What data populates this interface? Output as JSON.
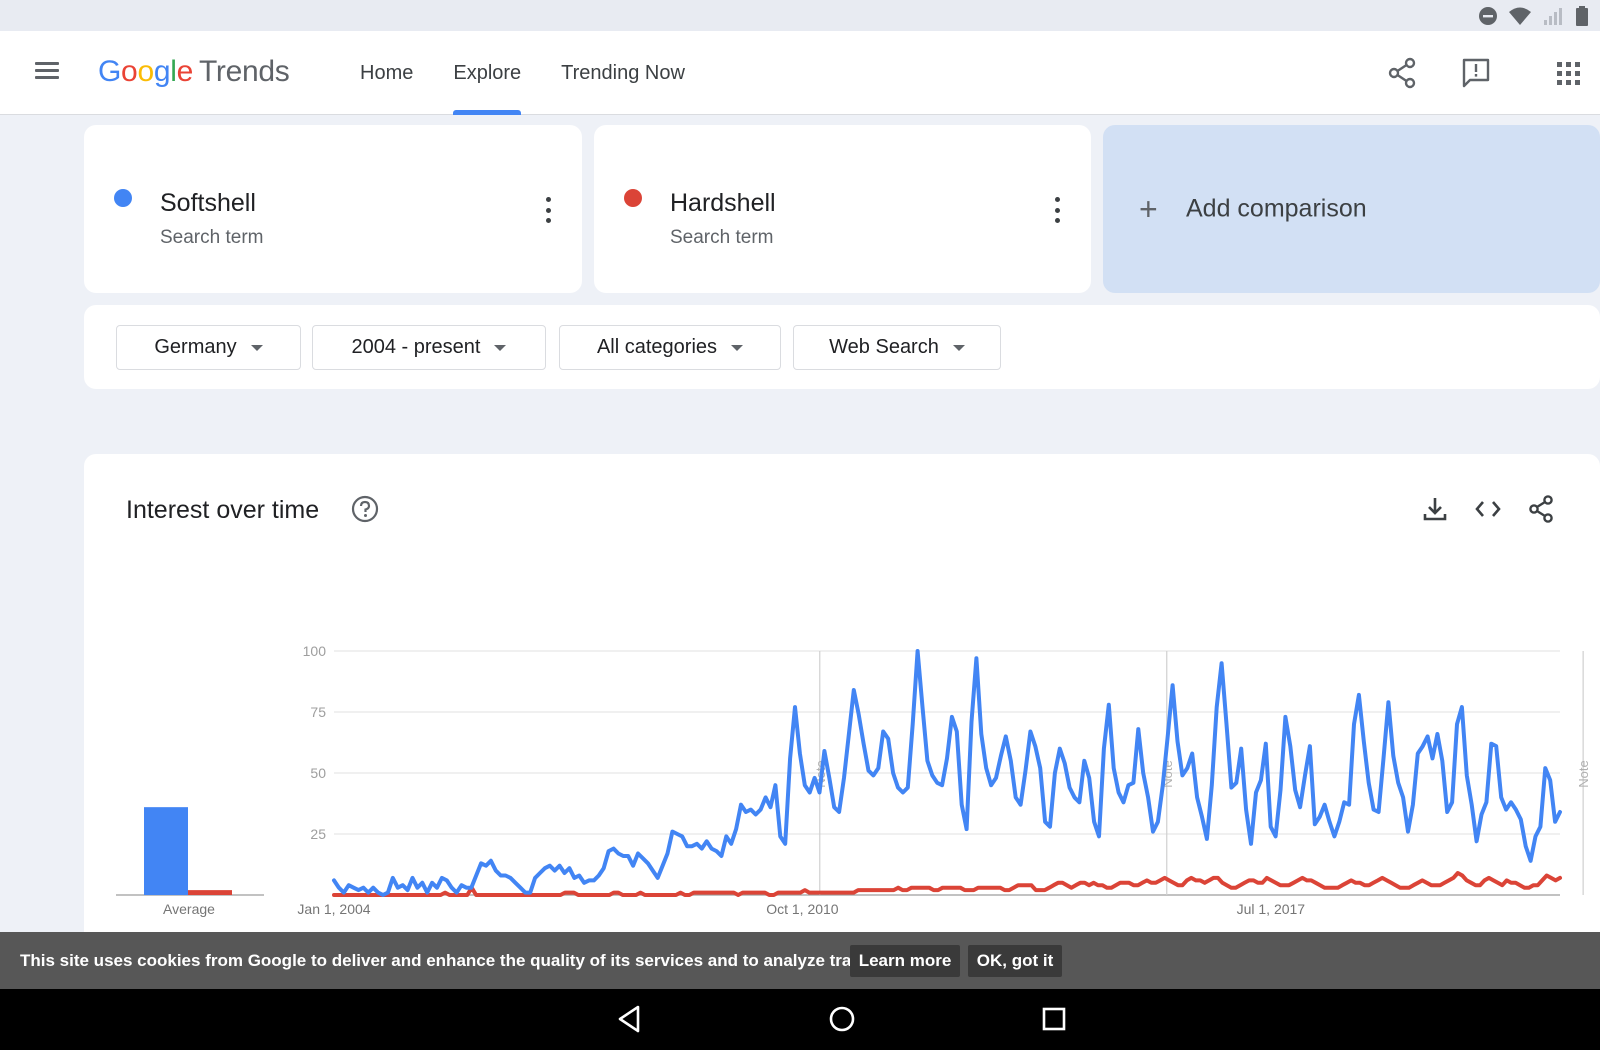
{
  "app": {
    "logo_google": [
      "G",
      "o",
      "o",
      "g",
      "l",
      "e"
    ],
    "logo_trends": "Trends"
  },
  "nav": {
    "tabs": [
      {
        "label": "Home",
        "active": false
      },
      {
        "label": "Explore",
        "active": true
      },
      {
        "label": "Trending Now",
        "active": false
      }
    ]
  },
  "terms": [
    {
      "name": "Softshell",
      "subtitle": "Search term",
      "color": "#4285f4"
    },
    {
      "name": "Hardshell",
      "subtitle": "Search term",
      "color": "#db4437"
    }
  ],
  "add_comparison": {
    "plus": "+",
    "label": "Add comparison"
  },
  "filters": {
    "region": "Germany",
    "time": "2004 - present",
    "category": "All categories",
    "search_type": "Web Search"
  },
  "interest": {
    "title": "Interest over time",
    "average_label": "Average"
  },
  "cookie": {
    "text": "This site uses cookies from Google to deliver and enhance the quality of its services and to analyze traffic.",
    "learn_more": "Learn more",
    "ok": "OK, got it"
  },
  "colors": {
    "blue": "#4285f4",
    "red": "#db4437",
    "accent": "#4285f4"
  },
  "chart_data": {
    "type": "line",
    "title": "Interest over time",
    "x_start": "2004-01",
    "x_end": "2021-09",
    "ylim": [
      0,
      100
    ],
    "y_ticks": [
      25,
      50,
      75,
      100
    ],
    "x_tick_labels": [
      {
        "label": "Jan 1, 2004",
        "date": "2004-01"
      },
      {
        "label": "Oct 1, 2010",
        "date": "2010-10"
      },
      {
        "label": "Jul 1, 2017",
        "date": "2017-07"
      }
    ],
    "notes": [
      {
        "label": "Note",
        "date": "2011-01"
      },
      {
        "label": "Note",
        "date": "2016-01"
      },
      {
        "label": "Note",
        "date": "2022-01"
      }
    ],
    "average": {
      "Softshell": 36,
      "Hardshell": 2
    },
    "series": [
      {
        "name": "Softshell",
        "color": "#4285f4",
        "values": [
          6,
          3,
          1,
          4,
          3,
          2,
          3,
          1,
          3,
          1,
          0,
          1,
          7,
          3,
          4,
          2,
          7,
          3,
          5,
          1,
          5,
          3,
          7,
          6,
          3,
          1,
          4,
          3,
          3,
          8,
          13,
          12,
          14,
          10,
          8,
          8,
          7,
          5,
          3,
          1,
          1,
          7,
          9,
          11,
          12,
          10,
          12,
          9,
          11,
          7,
          8,
          5,
          6,
          6,
          8,
          11,
          18,
          19,
          17,
          16,
          16,
          12,
          17,
          15,
          13,
          10,
          7,
          12,
          17,
          26,
          25,
          24,
          20,
          20,
          21,
          19,
          22,
          19,
          18,
          16,
          24,
          21,
          27,
          37,
          34,
          35,
          33,
          35,
          40,
          36,
          45,
          24,
          21,
          56,
          77,
          58,
          45,
          42,
          48,
          42,
          59,
          48,
          36,
          34,
          48,
          66,
          84,
          74,
          62,
          51,
          49,
          52,
          67,
          64,
          50,
          44,
          42,
          44,
          70,
          100,
          77,
          55,
          49,
          46,
          45,
          56,
          73,
          67,
          37,
          27,
          71,
          97,
          66,
          52,
          45,
          48,
          57,
          65,
          55,
          40,
          37,
          51,
          67,
          61,
          52,
          30,
          28,
          50,
          60,
          54,
          44,
          40,
          38,
          55,
          48,
          30,
          24,
          60,
          78,
          52,
          42,
          38,
          45,
          46,
          68,
          50,
          40,
          26,
          30,
          45,
          65,
          86,
          63,
          49,
          52,
          58,
          40,
          32,
          23,
          45,
          77,
          95,
          70,
          44,
          46,
          60,
          35,
          21,
          42,
          47,
          62,
          28,
          24,
          43,
          73,
          61,
          43,
          36,
          49,
          61,
          29,
          32,
          37,
          30,
          24,
          30,
          38,
          37,
          70,
          82,
          63,
          46,
          35,
          34,
          56,
          79,
          57,
          46,
          40,
          26,
          37,
          58,
          61,
          65,
          56,
          66,
          55,
          34,
          38,
          70,
          77,
          49,
          37,
          22,
          33,
          38,
          62,
          61,
          40,
          35,
          38,
          35,
          31,
          20,
          14,
          24,
          28,
          52,
          47,
          30,
          34
        ]
      },
      {
        "name": "Hardshell",
        "color": "#db4437",
        "values": [
          0,
          0,
          0,
          0,
          0,
          0,
          0,
          0,
          0,
          0,
          0,
          0,
          0,
          0,
          0,
          0,
          0,
          0,
          0,
          0,
          0,
          0,
          0,
          0,
          0,
          1,
          0,
          0,
          0,
          0,
          0,
          3,
          0,
          0,
          0,
          0,
          0,
          0,
          0,
          0,
          0,
          0,
          0,
          0,
          0,
          0,
          0,
          0,
          0,
          0,
          0,
          0,
          1,
          1,
          1,
          0,
          0,
          0,
          0,
          0,
          0,
          0,
          0,
          1,
          1,
          0,
          0,
          0,
          0,
          1,
          0,
          0,
          0,
          0,
          0,
          0,
          0,
          0,
          1,
          0,
          0,
          1,
          1,
          1,
          1,
          1,
          1,
          1,
          1,
          1,
          1,
          0,
          1,
          1,
          1,
          1,
          1,
          1,
          0,
          0,
          1,
          1,
          1,
          1,
          1,
          1,
          2,
          1,
          1,
          1,
          1,
          1,
          1,
          1,
          1,
          1,
          1,
          1,
          2,
          2,
          2,
          2,
          2,
          2,
          2,
          2,
          2,
          3,
          2,
          2,
          3,
          3,
          3,
          3,
          3,
          2,
          2,
          3,
          3,
          3,
          3,
          3,
          2,
          2,
          2,
          3,
          3,
          3,
          3,
          3,
          3,
          2,
          2,
          3,
          4,
          4,
          4,
          4,
          2,
          2,
          2,
          3,
          4,
          5,
          5,
          4,
          3,
          4,
          5,
          5,
          4,
          5,
          4,
          4,
          3,
          3,
          4,
          5,
          5,
          5,
          4,
          4,
          5,
          6,
          5,
          5,
          6,
          7,
          6,
          5,
          4,
          4,
          6,
          7,
          6,
          6,
          5,
          6,
          7,
          7,
          5,
          4,
          3,
          3,
          4,
          5,
          6,
          6,
          5,
          5,
          7,
          6,
          5,
          4,
          4,
          4,
          5,
          6,
          7,
          6,
          6,
          5,
          4,
          3,
          3,
          3,
          3,
          4,
          5,
          6,
          5,
          5,
          4,
          4,
          5,
          6,
          7,
          6,
          5,
          4,
          3,
          3,
          3,
          4,
          5,
          6,
          5,
          4,
          4,
          4,
          5,
          6,
          7,
          9,
          8,
          6,
          5,
          4,
          4,
          6,
          7,
          6,
          5,
          4,
          6,
          5,
          5,
          4,
          3,
          3,
          4,
          4,
          6,
          8,
          7,
          6,
          7
        ]
      }
    ]
  }
}
